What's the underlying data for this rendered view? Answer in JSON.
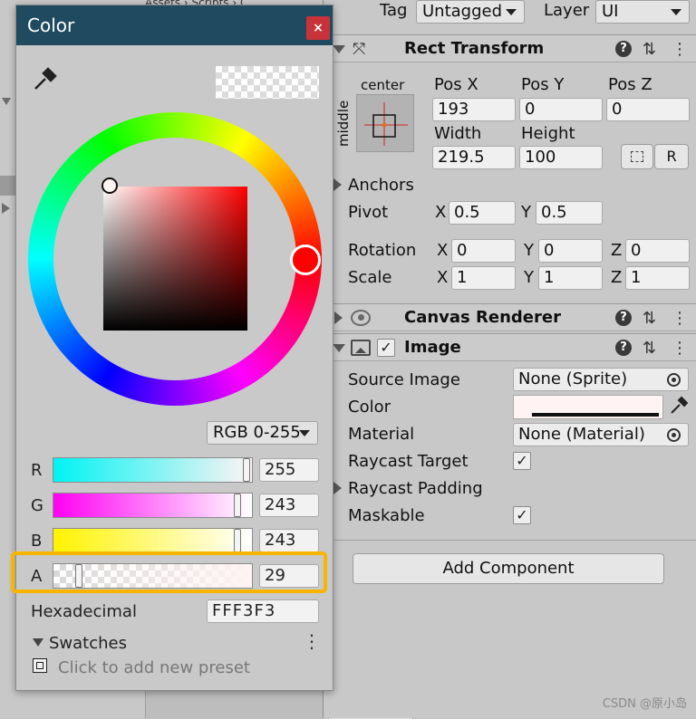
{
  "background_editor": {
    "top_tabs": "Assets › Scripts › C"
  },
  "inspector": {
    "tag_label": "Tag",
    "tag_value": "Untagged",
    "layer_label": "Layer",
    "layer_value": "UI",
    "rect_transform": {
      "title": "Rect Transform",
      "anchor_preset_top": "center",
      "anchor_preset_side": "middle",
      "pos_x_label": "Pos X",
      "pos_y_label": "Pos Y",
      "pos_z_label": "Pos Z",
      "pos_x": "193",
      "pos_y": "0",
      "pos_z": "0",
      "width_label": "Width",
      "height_label": "Height",
      "width": "219.5",
      "height": "100",
      "raw_edit_label": "R",
      "anchors_label": "Anchors",
      "pivot_label": "Pivot",
      "pivot_x_label": "X",
      "pivot_x": "0.5",
      "pivot_y_label": "Y",
      "pivot_y": "0.5",
      "rotation_label": "Rotation",
      "scale_label": "Scale",
      "rotation": {
        "x": "0",
        "y": "0",
        "z": "0"
      },
      "scale": {
        "x": "1",
        "y": "1",
        "z": "1"
      },
      "axis_x": "X",
      "axis_y": "Y",
      "axis_z": "Z"
    },
    "canvas_renderer": {
      "title": "Canvas Renderer"
    },
    "image": {
      "title": "Image",
      "enabled_check": "✓",
      "source_image_label": "Source Image",
      "source_image_value": "None (Sprite)",
      "color_label": "Color",
      "material_label": "Material",
      "material_value": "None (Material)",
      "raycast_target_label": "Raycast Target",
      "raycast_target_check": "✓",
      "raycast_padding_label": "Raycast Padding",
      "maskable_label": "Maskable",
      "maskable_check": "✓"
    },
    "add_component_label": "Add Component",
    "help_glyph": "?"
  },
  "color_picker": {
    "title": "Color",
    "close_glyph": "×",
    "mode": "RGB 0-255",
    "r_label": "R",
    "r_value": "255",
    "r_fraction": 1.0,
    "g_label": "G",
    "g_value": "243",
    "g_fraction": 0.953,
    "b_label": "B",
    "b_value": "243",
    "b_fraction": 0.953,
    "a_label": "A",
    "a_value": "29",
    "a_fraction": 0.114,
    "hex_label": "Hexadecimal",
    "hex_value": "FFF3F3",
    "swatches_label": "Swatches",
    "add_preset_text": "Click to add new preset",
    "current_color": "#FFF3F3",
    "highlight_color": "#F7B500"
  },
  "watermark": "CSDN @原小岛"
}
